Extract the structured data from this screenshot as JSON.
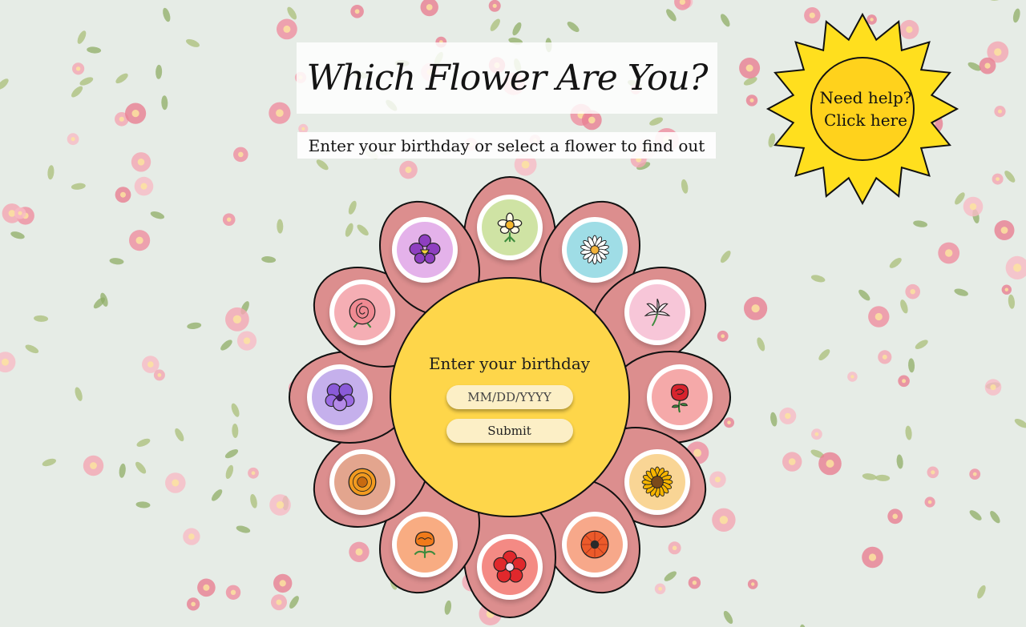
{
  "header": {
    "title": "Which Flower Are You?",
    "subtitle": "Enter your birthday or select a flower to find out"
  },
  "help": {
    "line1": "Need help?",
    "line2": "Click here"
  },
  "form": {
    "label": "Enter your birthday",
    "date_placeholder": "MM/DD/YYYY",
    "submit_label": "Submit"
  },
  "flowers": [
    {
      "icon": "daffodil-icon",
      "color": "#cfe3a4"
    },
    {
      "icon": "daisy-icon",
      "color": "#9fdde6"
    },
    {
      "icon": "lily-icon",
      "color": "#f7c6d8"
    },
    {
      "icon": "rose-icon",
      "color": "#f5a9a9"
    },
    {
      "icon": "sunflower-icon",
      "color": "#f9d595"
    },
    {
      "icon": "poppy-icon",
      "color": "#f7a88a"
    },
    {
      "icon": "holly-icon",
      "color": "#f48a84"
    },
    {
      "icon": "marigold-icon",
      "color": "#f8ac82"
    },
    {
      "icon": "chrysanthemum-icon",
      "color": "#e3a58e"
    },
    {
      "icon": "violet-icon",
      "color": "#c5b0ec"
    },
    {
      "icon": "carnation-icon",
      "color": "#f5aeb4"
    },
    {
      "icon": "orchid-icon",
      "color": "#e4b2ea"
    }
  ],
  "colors": {
    "petal": "#dc8e8e",
    "center": "#fed64a",
    "sun": "#ffd21c",
    "input": "#fcefc6"
  }
}
